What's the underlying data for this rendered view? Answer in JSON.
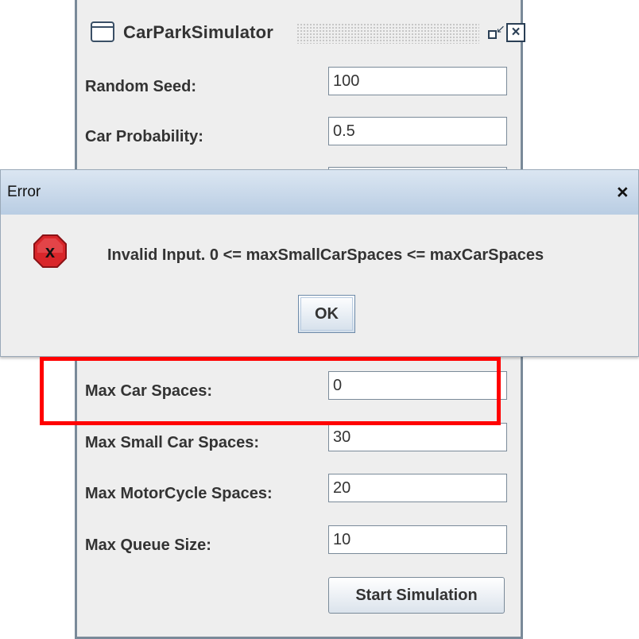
{
  "window": {
    "title": "CarParkSimulator"
  },
  "form": {
    "fields": [
      {
        "label": "Random Seed:",
        "value": "100"
      },
      {
        "label": "Car Probability:",
        "value": "0.5"
      },
      {
        "label": "",
        "value": ""
      },
      {
        "label": "Max Car Spaces:",
        "value": "0"
      },
      {
        "label": "Max Small Car Spaces:",
        "value": "30"
      },
      {
        "label": "Max MotorCycle Spaces:",
        "value": "20"
      },
      {
        "label": "Max Queue Size:",
        "value": "10"
      }
    ],
    "start_label": "Start Simulation"
  },
  "dialog": {
    "title": "Error",
    "close_label": "×",
    "message": "Invalid Input. 0 <= maxSmallCarSpaces <= maxCarSpaces",
    "ok_label": "OK",
    "icon": "error-x-icon"
  },
  "colors": {
    "highlight": "#ff0000",
    "error_icon": "#d9262a"
  }
}
